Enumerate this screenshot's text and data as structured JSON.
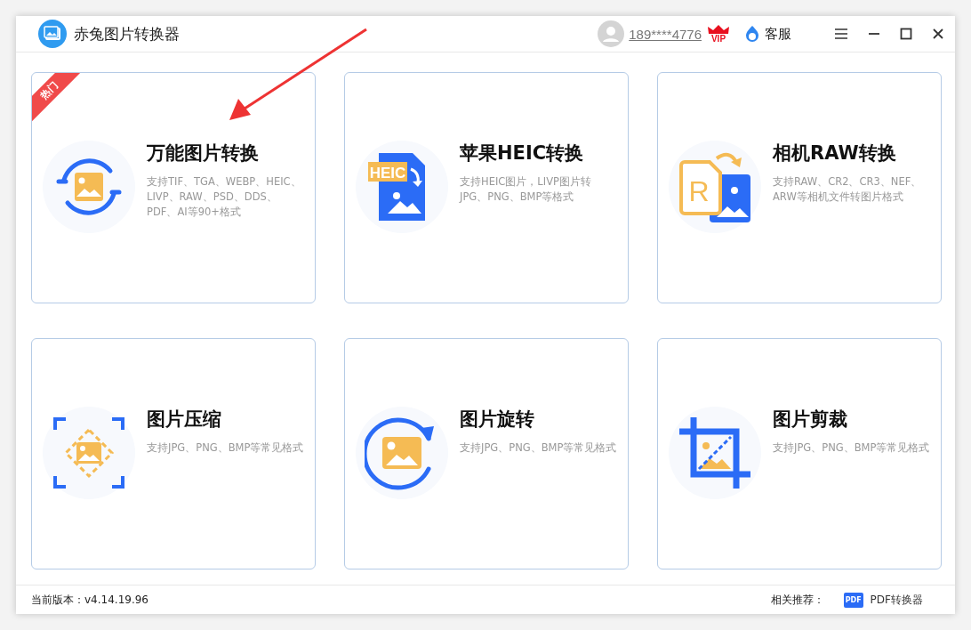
{
  "window": {
    "title": "赤兔图片转换器"
  },
  "header": {
    "user": "189****4776",
    "vip": "VIP",
    "service": "客服"
  },
  "cards": [
    {
      "kind": "convert",
      "title": "万能图片转换",
      "description": "支持TIF、TGA、WEBP、HEIC、LIVP、RAW、PSD、DDS、PDF、AI等90+格式",
      "badge": "热门"
    },
    {
      "kind": "heic",
      "title": "苹果HEIC转换",
      "description": "支持HEIC图片，LIVP图片转JPG、PNG、BMP等格式",
      "icon_text": "HEIC"
    },
    {
      "kind": "raw",
      "title": "相机RAW转换",
      "description": "支持RAW、CR2、CR3、NEF、ARW等相机文件转图片格式",
      "icon_text": "R"
    },
    {
      "kind": "compress",
      "title": "图片压缩",
      "description": "支持JPG、PNG、BMP等常见格式"
    },
    {
      "kind": "rotate",
      "title": "图片旋转",
      "description": "支持JPG、PNG、BMP等常见格式"
    },
    {
      "kind": "crop",
      "title": "图片剪裁",
      "description": "支持JPG、PNG、BMP等常见格式"
    }
  ],
  "status_bar": {
    "version": "当前版本：v4.14.19.96",
    "related_label": "相关推荐：",
    "related_app": "PDF转换器",
    "related_icon_text": "PDF"
  }
}
